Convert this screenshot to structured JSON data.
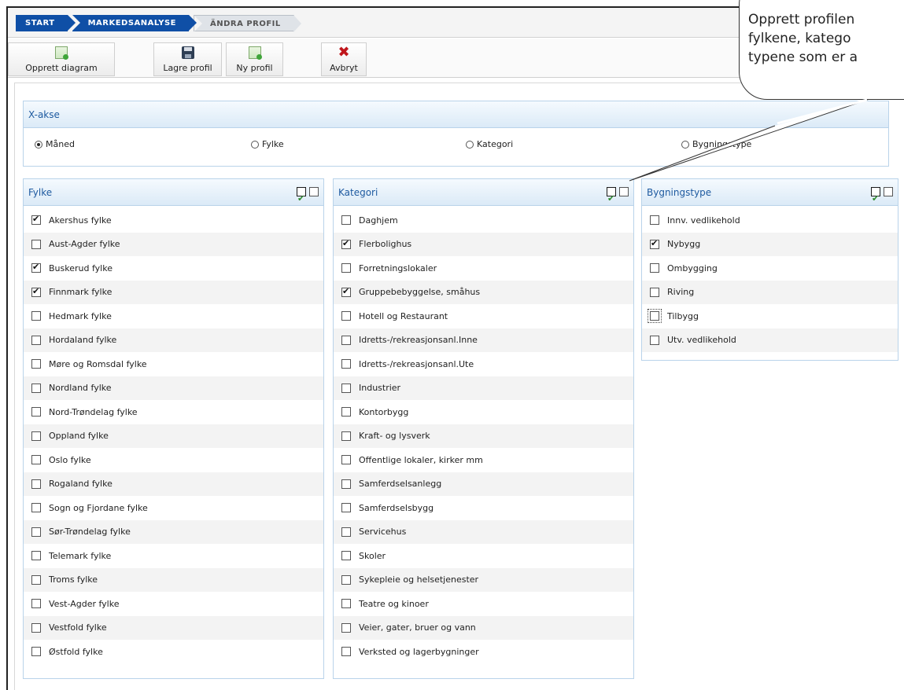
{
  "breadcrumb": [
    "START",
    "MARKEDSANALYSE",
    "ÄNDRA PROFIL"
  ],
  "toolbar": {
    "create_chart": "Opprett diagram",
    "save_profile": "Lagre profil",
    "new_profile": "Ny profil",
    "cancel": "Avbryt"
  },
  "xaxis": {
    "title": "X-akse",
    "options": [
      {
        "label": "Måned",
        "selected": true
      },
      {
        "label": "Fylke",
        "selected": false
      },
      {
        "label": "Kategori",
        "selected": false
      },
      {
        "label": "Bygningstype",
        "selected": false
      }
    ]
  },
  "fylke": {
    "title": "Fylke",
    "items": [
      {
        "label": "Akershus fylke",
        "checked": true
      },
      {
        "label": "Aust-Agder fylke",
        "checked": false
      },
      {
        "label": "Buskerud fylke",
        "checked": true
      },
      {
        "label": "Finnmark fylke",
        "checked": true
      },
      {
        "label": "Hedmark fylke",
        "checked": false
      },
      {
        "label": "Hordaland fylke",
        "checked": false
      },
      {
        "label": "Møre og Romsdal fylke",
        "checked": false
      },
      {
        "label": "Nordland fylke",
        "checked": false
      },
      {
        "label": "Nord-Trøndelag fylke",
        "checked": false
      },
      {
        "label": "Oppland fylke",
        "checked": false
      },
      {
        "label": "Oslo fylke",
        "checked": false
      },
      {
        "label": "Rogaland fylke",
        "checked": false
      },
      {
        "label": "Sogn og Fjordane fylke",
        "checked": false
      },
      {
        "label": "Sør-Trøndelag fylke",
        "checked": false
      },
      {
        "label": "Telemark fylke",
        "checked": false
      },
      {
        "label": "Troms fylke",
        "checked": false
      },
      {
        "label": "Vest-Agder fylke",
        "checked": false
      },
      {
        "label": "Vestfold fylke",
        "checked": false
      },
      {
        "label": "Østfold fylke",
        "checked": false
      }
    ]
  },
  "kategori": {
    "title": "Kategori",
    "items": [
      {
        "label": "Daghjem",
        "checked": false
      },
      {
        "label": "Flerbolighus",
        "checked": true
      },
      {
        "label": "Forretningslokaler",
        "checked": false
      },
      {
        "label": "Gruppebebyggelse, småhus",
        "checked": true
      },
      {
        "label": "Hotell og Restaurant",
        "checked": false
      },
      {
        "label": "Idretts-/rekreasjonsanl.Inne",
        "checked": false
      },
      {
        "label": "Idretts-/rekreasjonsanl.Ute",
        "checked": false
      },
      {
        "label": "Industrier",
        "checked": false
      },
      {
        "label": "Kontorbygg",
        "checked": false
      },
      {
        "label": "Kraft- og lysverk",
        "checked": false
      },
      {
        "label": "Offentlige lokaler, kirker mm",
        "checked": false
      },
      {
        "label": "Samferdselsanlegg",
        "checked": false
      },
      {
        "label": "Samferdselsbygg",
        "checked": false
      },
      {
        "label": "Servicehus",
        "checked": false
      },
      {
        "label": "Skoler",
        "checked": false
      },
      {
        "label": "Sykepleie og helsetjenester",
        "checked": false
      },
      {
        "label": "Teatre og kinoer",
        "checked": false
      },
      {
        "label": "Veier, gater, bruer og vann",
        "checked": false
      },
      {
        "label": "Verksted og lagerbygninger",
        "checked": false
      }
    ]
  },
  "bygningstype": {
    "title": "Bygningstype",
    "items": [
      {
        "label": "Innv. vedlikehold",
        "checked": false
      },
      {
        "label": "Nybygg",
        "checked": true
      },
      {
        "label": "Ombygging",
        "checked": false
      },
      {
        "label": "Riving",
        "checked": false
      },
      {
        "label": "Tilbygg",
        "checked": false,
        "focused": true
      },
      {
        "label": "Utv. vedlikehold",
        "checked": false
      }
    ]
  },
  "callout": {
    "lines": [
      "Opprett profilen",
      "fylkene, katego",
      "typene som er a"
    ]
  }
}
